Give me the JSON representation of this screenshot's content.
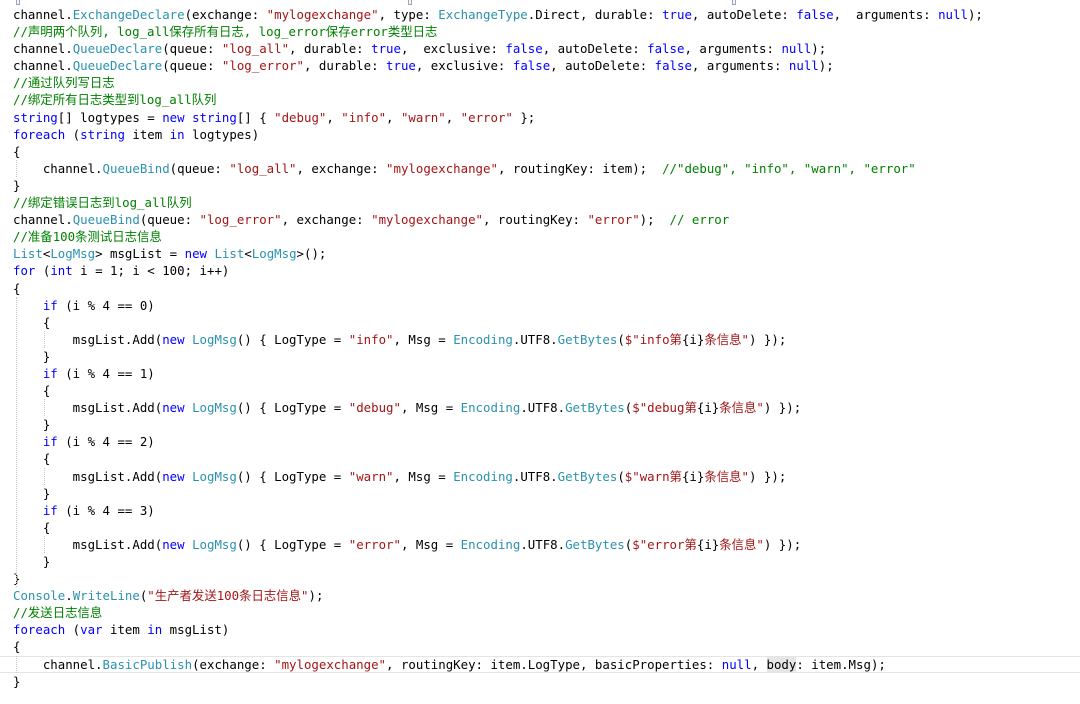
{
  "editor": {
    "language": "C#",
    "colors": {
      "keyword": "#0000ff",
      "type": "#2b91af",
      "string": "#a31515",
      "comment": "#008000",
      "text": "#000000",
      "background": "#ffffff"
    },
    "lines": [
      [
        [
          "pl",
          "channel."
        ],
        [
          "ty",
          "ExchangeDeclare"
        ],
        [
          "pl",
          "(exchange: "
        ],
        [
          "st",
          "\"mylogexchange\""
        ],
        [
          "pl",
          ", type: "
        ],
        [
          "ty",
          "ExchangeType"
        ],
        [
          "pl",
          ".Direct, durable: "
        ],
        [
          "kw",
          "true"
        ],
        [
          "pl",
          ", autoDelete: "
        ],
        [
          "kw",
          "false"
        ],
        [
          "pl",
          ",  arguments: "
        ],
        [
          "kw",
          "null"
        ],
        [
          "pl",
          ");"
        ]
      ],
      [
        [
          "cm",
          "//声明两个队列, log_all保存所有日志, log_error保存error类型日志"
        ]
      ],
      [
        [
          "pl",
          "channel."
        ],
        [
          "ty",
          "QueueDeclare"
        ],
        [
          "pl",
          "(queue: "
        ],
        [
          "st",
          "\"log_all\""
        ],
        [
          "pl",
          ", durable: "
        ],
        [
          "kw",
          "true"
        ],
        [
          "pl",
          ",  exclusive: "
        ],
        [
          "kw",
          "false"
        ],
        [
          "pl",
          ", autoDelete: "
        ],
        [
          "kw",
          "false"
        ],
        [
          "pl",
          ", arguments: "
        ],
        [
          "kw",
          "null"
        ],
        [
          "pl",
          ");"
        ]
      ],
      [
        [
          "pl",
          "channel."
        ],
        [
          "ty",
          "QueueDeclare"
        ],
        [
          "pl",
          "(queue: "
        ],
        [
          "st",
          "\"log_error\""
        ],
        [
          "pl",
          ", durable: "
        ],
        [
          "kw",
          "true"
        ],
        [
          "pl",
          ", exclusive: "
        ],
        [
          "kw",
          "false"
        ],
        [
          "pl",
          ", autoDelete: "
        ],
        [
          "kw",
          "false"
        ],
        [
          "pl",
          ", arguments: "
        ],
        [
          "kw",
          "null"
        ],
        [
          "pl",
          ");"
        ]
      ],
      [
        [
          "cm",
          "//通过队列写日志"
        ]
      ],
      [
        [
          "cm",
          "//绑定所有日志类型到log_all队列"
        ]
      ],
      [
        [
          "kw",
          "string"
        ],
        [
          "pl",
          "[] logtypes = "
        ],
        [
          "kw",
          "new"
        ],
        [
          "pl",
          " "
        ],
        [
          "kw",
          "string"
        ],
        [
          "pl",
          "[] { "
        ],
        [
          "st",
          "\"debug\""
        ],
        [
          "pl",
          ", "
        ],
        [
          "st",
          "\"info\""
        ],
        [
          "pl",
          ", "
        ],
        [
          "st",
          "\"warn\""
        ],
        [
          "pl",
          ", "
        ],
        [
          "st",
          "\"error\""
        ],
        [
          "pl",
          " };"
        ]
      ],
      [
        [
          "kw",
          "foreach"
        ],
        [
          "pl",
          " ("
        ],
        [
          "kw",
          "string"
        ],
        [
          "pl",
          " item "
        ],
        [
          "kw",
          "in"
        ],
        [
          "pl",
          " logtypes)"
        ]
      ],
      [
        [
          "pl",
          "{"
        ]
      ],
      [
        [
          "pl",
          "    channel."
        ],
        [
          "ty",
          "QueueBind"
        ],
        [
          "pl",
          "(queue: "
        ],
        [
          "st",
          "\"log_all\""
        ],
        [
          "pl",
          ", exchange: "
        ],
        [
          "st",
          "\"mylogexchange\""
        ],
        [
          "pl",
          ", routingKey: item);  "
        ],
        [
          "cm",
          "//\"debug\", \"info\", \"warn\", \"error\""
        ]
      ],
      [
        [
          "pl",
          "}"
        ]
      ],
      [
        [
          "cm",
          "//绑定错误日志到log_all队列"
        ]
      ],
      [
        [
          "pl",
          "channel."
        ],
        [
          "ty",
          "QueueBind"
        ],
        [
          "pl",
          "(queue: "
        ],
        [
          "st",
          "\"log_error\""
        ],
        [
          "pl",
          ", exchange: "
        ],
        [
          "st",
          "\"mylogexchange\""
        ],
        [
          "pl",
          ", routingKey: "
        ],
        [
          "st",
          "\"error\""
        ],
        [
          "pl",
          ");  "
        ],
        [
          "cm",
          "// error"
        ]
      ],
      [
        [
          "cm",
          "//准备100条测试日志信息"
        ]
      ],
      [
        [
          "ty",
          "List"
        ],
        [
          "pl",
          "<"
        ],
        [
          "ty",
          "LogMsg"
        ],
        [
          "pl",
          "> msgList = "
        ],
        [
          "kw",
          "new"
        ],
        [
          "pl",
          " "
        ],
        [
          "ty",
          "List"
        ],
        [
          "pl",
          "<"
        ],
        [
          "ty",
          "LogMsg"
        ],
        [
          "pl",
          ">();"
        ]
      ],
      [
        [
          "kw",
          "for"
        ],
        [
          "pl",
          " ("
        ],
        [
          "kw",
          "int"
        ],
        [
          "pl",
          " i = 1; i < 100; i++)"
        ]
      ],
      [
        [
          "pl",
          "{"
        ]
      ],
      [
        [
          "pl",
          "    "
        ],
        [
          "kw",
          "if"
        ],
        [
          "pl",
          " (i % 4 == 0)"
        ]
      ],
      [
        [
          "pl",
          "    {"
        ]
      ],
      [
        [
          "pl",
          "        msgList.Add("
        ],
        [
          "kw",
          "new"
        ],
        [
          "pl",
          " "
        ],
        [
          "ty",
          "LogMsg"
        ],
        [
          "pl",
          "() { LogType = "
        ],
        [
          "st",
          "\"info\""
        ],
        [
          "pl",
          ", Msg = "
        ],
        [
          "ty",
          "Encoding"
        ],
        [
          "pl",
          ".UTF8."
        ],
        [
          "ty",
          "GetBytes"
        ],
        [
          "pl",
          "("
        ],
        [
          "st",
          "$\"info第"
        ],
        [
          "pl",
          "{i}"
        ],
        [
          "st",
          "条信息\""
        ],
        [
          "pl",
          ") });"
        ]
      ],
      [
        [
          "pl",
          "    }"
        ]
      ],
      [
        [
          "pl",
          "    "
        ],
        [
          "kw",
          "if"
        ],
        [
          "pl",
          " (i % 4 == 1)"
        ]
      ],
      [
        [
          "pl",
          "    {"
        ]
      ],
      [
        [
          "pl",
          "        msgList.Add("
        ],
        [
          "kw",
          "new"
        ],
        [
          "pl",
          " "
        ],
        [
          "ty",
          "LogMsg"
        ],
        [
          "pl",
          "() { LogType = "
        ],
        [
          "st",
          "\"debug\""
        ],
        [
          "pl",
          ", Msg = "
        ],
        [
          "ty",
          "Encoding"
        ],
        [
          "pl",
          ".UTF8."
        ],
        [
          "ty",
          "GetBytes"
        ],
        [
          "pl",
          "("
        ],
        [
          "st",
          "$\"debug第"
        ],
        [
          "pl",
          "{i}"
        ],
        [
          "st",
          "条信息\""
        ],
        [
          "pl",
          ") });"
        ]
      ],
      [
        [
          "pl",
          "    }"
        ]
      ],
      [
        [
          "pl",
          "    "
        ],
        [
          "kw",
          "if"
        ],
        [
          "pl",
          " (i % 4 == 2)"
        ]
      ],
      [
        [
          "pl",
          "    {"
        ]
      ],
      [
        [
          "pl",
          "        msgList.Add("
        ],
        [
          "kw",
          "new"
        ],
        [
          "pl",
          " "
        ],
        [
          "ty",
          "LogMsg"
        ],
        [
          "pl",
          "() { LogType = "
        ],
        [
          "st",
          "\"warn\""
        ],
        [
          "pl",
          ", Msg = "
        ],
        [
          "ty",
          "Encoding"
        ],
        [
          "pl",
          ".UTF8."
        ],
        [
          "ty",
          "GetBytes"
        ],
        [
          "pl",
          "("
        ],
        [
          "st",
          "$\"warn第"
        ],
        [
          "pl",
          "{i}"
        ],
        [
          "st",
          "条信息\""
        ],
        [
          "pl",
          ") });"
        ]
      ],
      [
        [
          "pl",
          "    }"
        ]
      ],
      [
        [
          "pl",
          "    "
        ],
        [
          "kw",
          "if"
        ],
        [
          "pl",
          " (i % 4 == 3)"
        ]
      ],
      [
        [
          "pl",
          "    {"
        ]
      ],
      [
        [
          "pl",
          "        msgList.Add("
        ],
        [
          "kw",
          "new"
        ],
        [
          "pl",
          " "
        ],
        [
          "ty",
          "LogMsg"
        ],
        [
          "pl",
          "() { LogType = "
        ],
        [
          "st",
          "\"error\""
        ],
        [
          "pl",
          ", Msg = "
        ],
        [
          "ty",
          "Encoding"
        ],
        [
          "pl",
          ".UTF8."
        ],
        [
          "ty",
          "GetBytes"
        ],
        [
          "pl",
          "("
        ],
        [
          "st",
          "$\"error第"
        ],
        [
          "pl",
          "{i}"
        ],
        [
          "st",
          "条信息\""
        ],
        [
          "pl",
          ") });"
        ]
      ],
      [
        [
          "pl",
          "    }"
        ]
      ],
      [
        [
          "pl",
          "}"
        ]
      ],
      [
        [
          "ty",
          "Console"
        ],
        [
          "pl",
          "."
        ],
        [
          "ty",
          "WriteLine"
        ],
        [
          "pl",
          "("
        ],
        [
          "st",
          "\"生产者发送100条日志信息\""
        ],
        [
          "pl",
          ");"
        ]
      ],
      [
        [
          "cm",
          "//发送日志信息"
        ]
      ],
      [
        [
          "kw",
          "foreach"
        ],
        [
          "pl",
          " ("
        ],
        [
          "kw",
          "var"
        ],
        [
          "pl",
          " item "
        ],
        [
          "kw",
          "in"
        ],
        [
          "pl",
          " msgList)"
        ]
      ],
      [
        [
          "pl",
          "{"
        ]
      ],
      [
        [
          "pl",
          "    channel."
        ],
        [
          "ty",
          "BasicPublish"
        ],
        [
          "pl",
          "(exchange: "
        ],
        [
          "st",
          "\"mylogexchange\""
        ],
        [
          "pl",
          ", routingKey: item.LogType, basicProperties: "
        ],
        [
          "kw",
          "null"
        ],
        [
          "pl",
          ", "
        ],
        [
          "hl",
          "body"
        ],
        [
          "pl",
          ": item.Msg);"
        ]
      ],
      [
        [
          "pl",
          "}"
        ]
      ]
    ],
    "current_line": 38
  }
}
